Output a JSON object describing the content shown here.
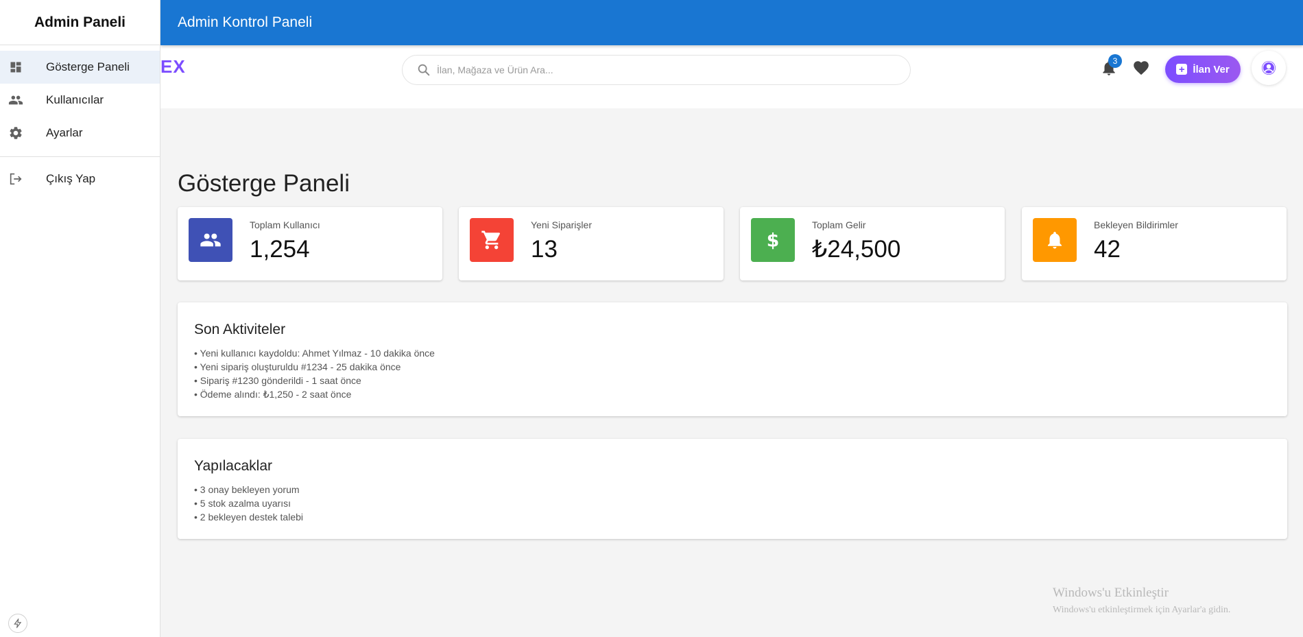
{
  "sidebar": {
    "title": "Admin Paneli",
    "items": [
      {
        "label": "Gösterge Paneli",
        "icon": "dashboard-icon",
        "active": true
      },
      {
        "label": "Kullanıcılar",
        "icon": "people-icon"
      },
      {
        "label": "Ayarlar",
        "icon": "gear-icon"
      }
    ],
    "logout_label": "Çıkış Yap"
  },
  "appbar": {
    "title": "Admin Kontrol Paneli"
  },
  "header": {
    "logo_text": "EX",
    "search_placeholder": "İlan, Mağaza ve Ürün Ara...",
    "notification_count": "3",
    "post_ad_label": "İlan Ver"
  },
  "main": {
    "title": "Gösterge Paneli",
    "stats": [
      {
        "label": "Toplam Kullanıcı",
        "value": "1,254",
        "color": "#3f51b5",
        "icon": "people-icon"
      },
      {
        "label": "Yeni Siparişler",
        "value": "13",
        "color": "#f44336",
        "icon": "cart-icon"
      },
      {
        "label": "Toplam Gelir",
        "value": "₺24,500",
        "color": "#4caf50",
        "icon": "dollar-icon"
      },
      {
        "label": "Bekleyen Bildirimler",
        "value": "42",
        "color": "#ff9800",
        "icon": "bell-icon"
      }
    ],
    "activities": {
      "title": "Son Aktiviteler",
      "items": [
        "• Yeni kullanıcı kaydoldu: Ahmet Yılmaz - 10 dakika önce",
        "• Yeni sipariş oluşturuldu #1234 - 25 dakika önce",
        "• Sipariş #1230 gönderildi - 1 saat önce",
        "• Ödeme alındı: ₺1,250 - 2 saat önce"
      ]
    },
    "todos": {
      "title": "Yapılacaklar",
      "items": [
        "• 3 onay bekleyen yorum",
        "• 5 stok azalma uyarısı",
        "• 2 bekleyen destek talebi"
      ]
    }
  },
  "watermark": {
    "line1": "Windows'u Etkinleştir",
    "line2": "Windows'u etkinleştirmek için Ayarlar'a gidin."
  }
}
